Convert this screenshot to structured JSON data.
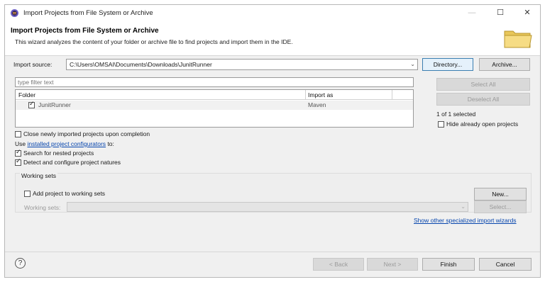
{
  "window": {
    "title": "Import Projects from File System or Archive",
    "minimize": "—",
    "maximize": "☐",
    "close": "✕"
  },
  "header": {
    "title": "Import Projects from File System or Archive",
    "description": "This wizard analyzes the content of your folder or archive file to find projects and import them in the IDE."
  },
  "import_source": {
    "label": "Import source:",
    "value": "C:\\Users\\OMSAI\\Documents\\Downloads\\JunitRunner",
    "directory_button": "Directory...",
    "archive_button": "Archive..."
  },
  "filter": {
    "placeholder": "type filter text"
  },
  "table": {
    "columns": [
      "Folder",
      "Import as"
    ],
    "rows": [
      {
        "folder": "JunitRunner",
        "import_as": "Maven",
        "checked": true
      }
    ]
  },
  "side": {
    "select_all": "Select All",
    "deselect_all": "Deselect All",
    "selected_count": "1 of 1 selected",
    "hide_open": "Hide already open projects"
  },
  "options": {
    "close_after": "Close newly imported projects upon completion",
    "use_prefix": "Use",
    "configurators_link": "installed project configurators",
    "use_suffix": "to:",
    "search_nested": "Search for nested projects",
    "detect_natures": "Detect and configure project natures"
  },
  "working_sets": {
    "title": "Working sets",
    "add_label": "Add project to working sets",
    "new_button": "New...",
    "sets_label": "Working sets:",
    "select_button": "Select..."
  },
  "show_other_link": "Show other specialized import wizards",
  "footer": {
    "help": "?",
    "back": "< Back",
    "next": "Next >",
    "finish": "Finish",
    "cancel": "Cancel"
  }
}
